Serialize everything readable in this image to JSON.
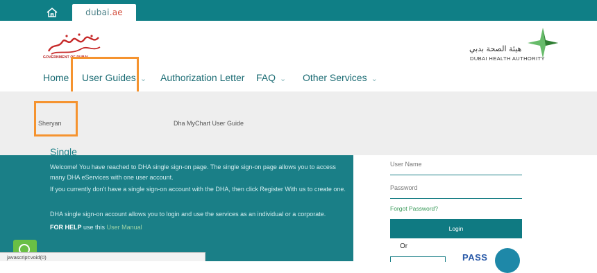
{
  "topbar": {
    "brand_main": "dubai",
    "brand_suffix": ".ae"
  },
  "header": {
    "gov_caption": "GOVERNMENT OF DUBAI",
    "dha_arabic": "هيئة الصحة بدبي",
    "dha_english": "DUBAI HEALTH AUTHORITY"
  },
  "nav": {
    "home": "Home",
    "user_guides": "User Guides",
    "authorization_letter": "Authorization Letter",
    "faq": "FAQ",
    "other_services": "Other Services"
  },
  "submenu": {
    "item1": "Sheryan",
    "item2": "Dha MyChart User Guide"
  },
  "content": {
    "p1": "Welcome! You have reached to DHA single sign-on page. The single sign-on page allows you to access many DHA eServices with one user account.",
    "p2": "If you currently don't have a single sign-on account with the DHA, then click Register With us to create one.",
    "p3": "DHA single sign-on account allows you to login and use the services as an individual or a corporate.",
    "help_label": "FOR HELP",
    "help_text": "use this",
    "help_link": "User Manual"
  },
  "login": {
    "username_placeholder": "User Name",
    "password_placeholder": "Password",
    "forgot": "Forgot Password?",
    "login_button": "Login",
    "or": "Or",
    "uae_pass_label": "PASS"
  },
  "status_bar": {
    "text": "javascript:void(0)"
  },
  "colors": {
    "teal": "#0f7f86",
    "highlight": "#f5932f",
    "link_green": "#3a9a5a"
  }
}
